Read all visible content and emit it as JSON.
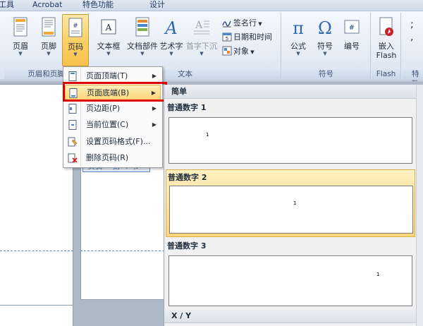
{
  "tabs": [
    {
      "label": "工具"
    },
    {
      "label": "Acrobat"
    },
    {
      "label": "特色功能"
    },
    {
      "label": "设计"
    }
  ],
  "ribbon": {
    "header_footer_group": {
      "label": "页眉和页脚",
      "header_btn": "页眉",
      "footer_btn": "页脚",
      "pagenum_btn": "页码"
    },
    "text_group": {
      "label": "文本",
      "textbox_btn": "文本框",
      "quickparts_btn": "文档部件",
      "wordart_btn": "艺术字",
      "dropcap_btn": "首字下沉",
      "signature_btn": "签名行",
      "datetime_btn": "日期和时间",
      "object_btn": "对象"
    },
    "symbol_group": {
      "label": "符号",
      "formula_btn": "公式",
      "symbol_btn": "符号",
      "number_btn": "编号"
    },
    "flash_group": {
      "label": "Flash",
      "insert_flash_btn_line1": "嵌入",
      "insert_flash_btn_line2": "Flash"
    },
    "special_group": {
      "label": "特殊"
    }
  },
  "menu": {
    "items": [
      {
        "label": "页面顶端(T)",
        "has_sub": true
      },
      {
        "label": "页面底端(B)",
        "has_sub": true,
        "highlighted": true
      },
      {
        "label": "页边距(P)",
        "has_sub": true
      },
      {
        "label": "当前位置(C)",
        "has_sub": true
      },
      {
        "label": "设置页码格式(F)...",
        "has_sub": false
      },
      {
        "label": "删除页码(R)",
        "has_sub": false
      }
    ]
  },
  "gallery": {
    "section_simple": "简单",
    "items": [
      {
        "title": "普通数字 1",
        "num": "1"
      },
      {
        "title": "普通数字 2",
        "num": "1"
      },
      {
        "title": "普通数字 3",
        "num": "1"
      }
    ],
    "section_xy": "X / Y"
  },
  "document": {
    "footer_tag": "页脚 - 第 4 节 -"
  },
  "colors": {
    "highlight": "#fbd77a",
    "redbox": "#e00000",
    "footer_blue": "#2e64b0"
  }
}
